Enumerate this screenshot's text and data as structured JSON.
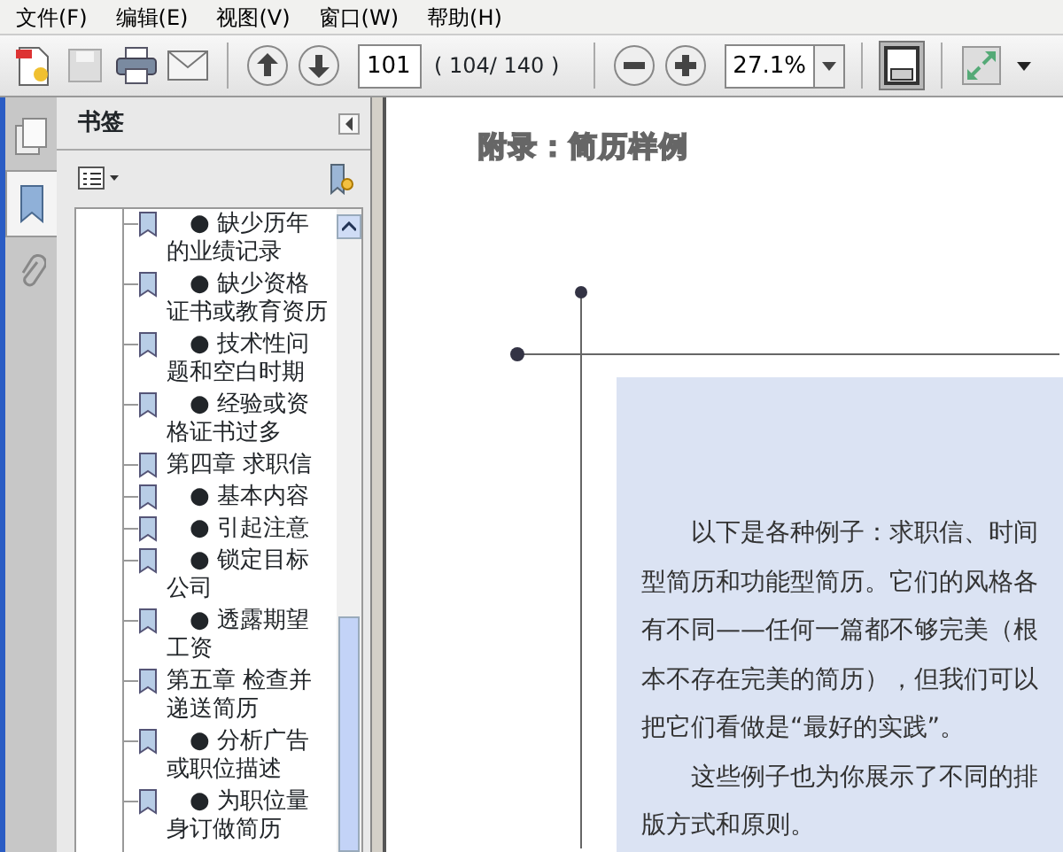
{
  "menu": [
    {
      "label": "文件(F)"
    },
    {
      "label": "编辑(E)"
    },
    {
      "label": "视图(V)"
    },
    {
      "label": "窗口(W)"
    },
    {
      "label": "帮助(H)"
    }
  ],
  "toolbar": {
    "page_field": "101",
    "page_count": "( 104/ 140 )",
    "zoom_field": "27.1%"
  },
  "side_tabs": [
    {
      "kind": "pages",
      "selected": false
    },
    {
      "kind": "bookmarks",
      "selected": true
    },
    {
      "kind": "attachments",
      "selected": false
    }
  ],
  "bookmark_panel": {
    "title": "书签",
    "items": [
      {
        "kind": "bullet",
        "label": "● 缺少历年的业绩记录"
      },
      {
        "kind": "bullet",
        "label": "● 缺少资格证书或教育资历"
      },
      {
        "kind": "bullet",
        "label": "● 技术性问题和空白时期"
      },
      {
        "kind": "bullet",
        "label": "● 经验或资格证书过多"
      },
      {
        "kind": "chapter",
        "label": "第四章 求职信"
      },
      {
        "kind": "bullet",
        "label": "● 基本内容"
      },
      {
        "kind": "bullet",
        "label": "● 引起注意"
      },
      {
        "kind": "bullet",
        "label": "● 锁定目标公司"
      },
      {
        "kind": "bullet",
        "label": "● 透露期望工资"
      },
      {
        "kind": "chapter",
        "label": "第五章 检查并递送简历"
      },
      {
        "kind": "bullet",
        "label": "● 分析广告或职位描述"
      },
      {
        "kind": "bullet",
        "label": "● 为职位量身订做简历"
      }
    ]
  },
  "document": {
    "heading": "附录：简历样例",
    "paragraphs": [
      "以下是各种例子：求职信、时间型简历和功能型简历。它们的风格各有不同——任何一篇都不够完美（根本不存在完美的简历），但我们可以把它们看做是“最好的实践”。",
      "这些例子也为你展示了不同的排版方式和原则。"
    ]
  }
}
